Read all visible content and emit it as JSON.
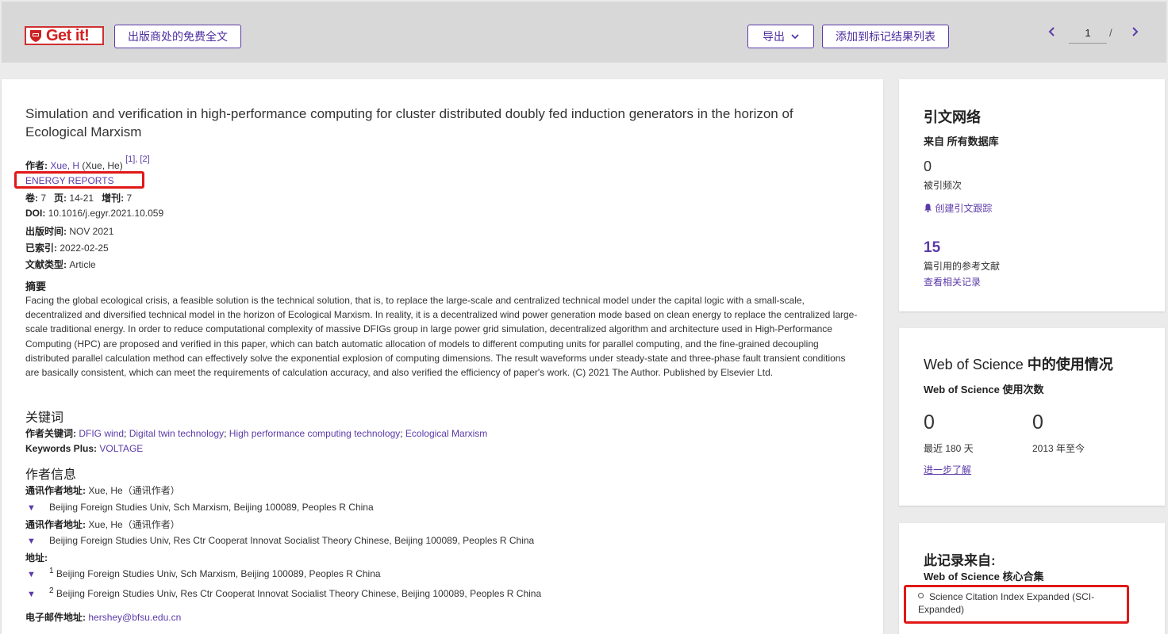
{
  "toolbar": {
    "logo_text": "Get it!",
    "free_fulltext": "出版商处的免费全文",
    "export": "导出",
    "add_marked": "添加到标记结果列表",
    "page_current": "1",
    "page_sep": "/"
  },
  "record": {
    "title": "Simulation and verification in high-performance computing for cluster distributed doubly fed induction generators in the horizon of Ecological Marxism",
    "author_label": "作者:",
    "author_name": "Xue, H",
    "author_full": "(Xue, He)",
    "author_sup": "[1], [2]",
    "journal": "ENERGY REPORTS",
    "volume_label": "卷:",
    "volume": "7",
    "pages_label": "页:",
    "pages": "14-21",
    "supplement_label": "增刊:",
    "supplement": "7",
    "doi_label": "DOI:",
    "doi": "10.1016/j.egyr.2021.10.059",
    "pub_date_label": "出版时间:",
    "pub_date": "NOV 2021",
    "indexed_label": "已索引:",
    "indexed": "2022-02-25",
    "doctype_label": "文献类型:",
    "doctype": "Article",
    "abstract_label": "摘要",
    "abstract": "Facing the global ecological crisis, a feasible solution is the technical solution, that is, to replace the large-scale and centralized technical model under the capital logic with a small-scale, decentralized and diversified technical model in the horizon of Ecological Marxism. In reality, it is a decentralized wind power generation mode based on clean energy to replace the centralized large-scale traditional energy. In order to reduce computational complexity of massive DFIGs group in large power grid simulation, decentralized algorithm and architecture used in High-Performance Computing (HPC) are proposed and verified in this paper, which can batch automatic allocation of models to different computing units for parallel computing, and the fine-grained decoupling distributed parallel calculation method can effectively solve the exponential explosion of computing dimensions. The result waveforms under steady-state and three-phase fault transient conditions are basically consistent, which can meet the requirements of calculation accuracy, and also verified the efficiency of paper's work. (C) 2021 The Author. Published by Elsevier Ltd.",
    "keywords_heading": "关键词",
    "author_keywords_label": "作者关键词:",
    "author_keywords": [
      "DFIG wind",
      "Digital twin technology",
      "High performance computing technology",
      "Ecological Marxism"
    ],
    "keywords_plus_label": "Keywords Plus:",
    "keywords_plus": "VOLTAGE",
    "author_info_heading": "作者信息",
    "corr_label": "通讯作者地址:",
    "corr_name": "Xue, He（通讯作者）",
    "corr_addr_1": "Beijing Foreign Studies Univ, Sch Marxism, Beijing 100089, Peoples R China",
    "corr_addr_2": "Beijing Foreign Studies Univ, Res Ctr Cooperat Innovat Socialist Theory Chinese, Beijing 100089, Peoples R China",
    "address_label": "地址:",
    "addr_num_1": "1",
    "addr_1": "Beijing Foreign Studies Univ, Sch Marxism, Beijing 100089, Peoples R China",
    "addr_num_2": "2",
    "addr_2": "Beijing Foreign Studies Univ, Res Ctr Cooperat Innovat Socialist Theory Chinese, Beijing 100089, Peoples R China",
    "email_label": "电子邮件地址:",
    "email": "hershey@bfsu.edu.cn"
  },
  "citation_network": {
    "title": "引文网络",
    "source": "来自 所有数据库",
    "times_cited": "0",
    "times_cited_label": "被引频次",
    "create_alert": "创建引文跟踪",
    "refs_count": "15",
    "refs_label": "篇引用的参考文献",
    "view_related": "查看相关记录"
  },
  "usage": {
    "title_prefix": "Web of Science",
    "title_suffix": "中的使用情况",
    "sub_prefix": "Web of Science",
    "sub_suffix": "使用次数",
    "last180": "0",
    "last180_label": "最近 180 天",
    "since2013": "0",
    "since2013_label": "2013 年至今",
    "learn_more": "进一步了解"
  },
  "source_record": {
    "title": "此记录来自:",
    "collection": "Web of Science 核心合集",
    "index": "Science Citation Index Expanded (SCI-Expanded)"
  },
  "colors": {
    "accent": "#5b3aa8",
    "highlight_box": "#e01818",
    "logo_red": "#d41f1f"
  }
}
